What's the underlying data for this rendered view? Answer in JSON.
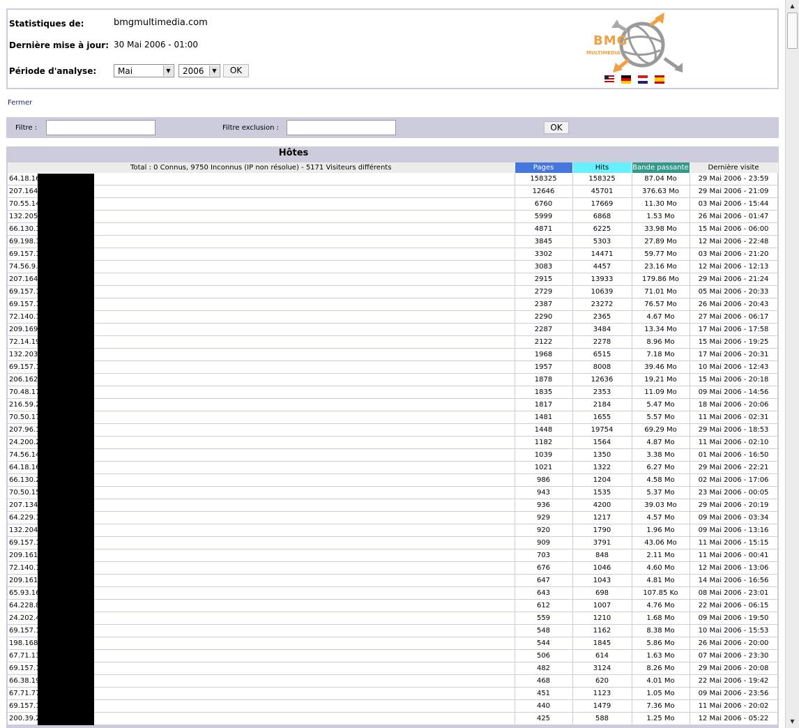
{
  "header": {
    "stats_label": "Statistiques de:",
    "site": "bmgmultimedia.com",
    "update_label": "Dernière mise à jour:",
    "update_value": "30 Mai 2006 - 01:00",
    "period_label": "Période d'analyse:",
    "month_selected": "Mai",
    "year_selected": "2006",
    "ok_label": "OK",
    "logo_text": "BMG",
    "logo_subtext": "MULTIMEDIA"
  },
  "close_link": "Fermer",
  "filter": {
    "filter_label": "Filtre :",
    "exclude_label": "Filtre exclusion :",
    "ok_label": "OK"
  },
  "hosts": {
    "title": "Hôtes",
    "summary": "Total : 0 Connus, 9750 Inconnus (IP non résolue) - 5171 Visiteurs différents",
    "columns": {
      "pages": "Pages",
      "hits": "Hits",
      "bandwidth": "Bande passante",
      "last_visit": "Dernière visite"
    },
    "colors": {
      "pages": "#4477dd",
      "hits": "#66f0ff",
      "bandwidth": "#339988",
      "panel": "#ccccdd"
    },
    "rows": [
      [
        "64.18.16",
        "158325",
        "158325",
        "87.04 Mo",
        "29 Mai 2006 - 23:59"
      ],
      [
        "207.164.",
        "12646",
        "45701",
        "376.63 Mo",
        "29 Mai 2006 - 21:09"
      ],
      [
        "70.55.14",
        "6760",
        "17669",
        "11.30 Mo",
        "03 Mai 2006 - 15:44"
      ],
      [
        "132.205.",
        "5999",
        "6868",
        "1.53 Mo",
        "26 Mai 2006 - 01:47"
      ],
      [
        "66.130.1",
        "4871",
        "6225",
        "33.98 Mo",
        "15 Mai 2006 - 06:00"
      ],
      [
        "69.198.1",
        "3845",
        "5303",
        "27.89 Mo",
        "12 Mai 2006 - 22:48"
      ],
      [
        "69.157.1",
        "3302",
        "14471",
        "59.77 Mo",
        "03 Mai 2006 - 21:20"
      ],
      [
        "74.56.9.2",
        "3083",
        "4457",
        "23.16 Mo",
        "12 Mai 2006 - 12:13"
      ],
      [
        "207.164.",
        "2915",
        "13933",
        "179.86 Mo",
        "29 Mai 2006 - 21:24"
      ],
      [
        "69.157.1",
        "2729",
        "10639",
        "71.01 Mo",
        "05 Mai 2006 - 20:33"
      ],
      [
        "69.157.1",
        "2387",
        "23272",
        "76.57 Mo",
        "26 Mai 2006 - 20:43"
      ],
      [
        "72.140.1",
        "2290",
        "2365",
        "4.67 Mo",
        "27 Mai 2006 - 06:17"
      ],
      [
        "209.169.",
        "2287",
        "3484",
        "13.34 Mo",
        "17 Mai 2006 - 17:58"
      ],
      [
        "72.14.19",
        "2122",
        "2278",
        "8.96 Mo",
        "15 Mai 2006 - 19:25"
      ],
      [
        "132.203.",
        "1968",
        "6515",
        "7.18 Mo",
        "17 Mai 2006 - 20:31"
      ],
      [
        "69.157.1",
        "1957",
        "8008",
        "39.46 Mo",
        "10 Mai 2006 - 12:43"
      ],
      [
        "206.162.",
        "1878",
        "12636",
        "19.21 Mo",
        "15 Mai 2006 - 20:18"
      ],
      [
        "70.48.17",
        "1835",
        "2353",
        "11.09 Mo",
        "09 Mai 2006 - 14:56"
      ],
      [
        "216.59.2",
        "1817",
        "2184",
        "5.47 Mo",
        "18 Mai 2006 - 20:06"
      ],
      [
        "70.50.17",
        "1481",
        "1655",
        "5.57 Mo",
        "11 Mai 2006 - 02:31"
      ],
      [
        "207.96.1",
        "1448",
        "19754",
        "69.29 Mo",
        "29 Mai 2006 - 18:53"
      ],
      [
        "24.200.2",
        "1182",
        "1564",
        "4.87 Mo",
        "11 Mai 2006 - 02:10"
      ],
      [
        "74.56.14",
        "1039",
        "1350",
        "3.38 Mo",
        "01 Mai 2006 - 16:50"
      ],
      [
        "64.18.16",
        "1021",
        "1322",
        "6.27 Mo",
        "29 Mai 2006 - 22:21"
      ],
      [
        "66.130.2",
        "986",
        "1204",
        "4.58 Mo",
        "02 Mai 2006 - 17:06"
      ],
      [
        "70.50.15",
        "943",
        "1535",
        "5.37 Mo",
        "23 Mai 2006 - 00:05"
      ],
      [
        "207.134.",
        "936",
        "4200",
        "39.03 Mo",
        "29 Mai 2006 - 20:19"
      ],
      [
        "64.229.1",
        "929",
        "1217",
        "4.57 Mo",
        "09 Mai 2006 - 03:34"
      ],
      [
        "132.204.",
        "920",
        "1790",
        "1.96 Mo",
        "09 Mai 2006 - 13:16"
      ],
      [
        "69.157.1",
        "909",
        "3791",
        "43.06 Mo",
        "11 Mai 2006 - 15:15"
      ],
      [
        "209.161.",
        "703",
        "848",
        "2.11 Mo",
        "11 Mai 2006 - 00:41"
      ],
      [
        "72.140.1",
        "676",
        "1046",
        "4.60 Mo",
        "12 Mai 2006 - 13:06"
      ],
      [
        "209.161.",
        "647",
        "1043",
        "4.81 Mo",
        "14 Mai 2006 - 16:56"
      ],
      [
        "65.93.16",
        "643",
        "698",
        "107.85 Ko",
        "08 Mai 2006 - 23:01"
      ],
      [
        "64.228.8",
        "612",
        "1007",
        "4.76 Mo",
        "22 Mai 2006 - 06:15"
      ],
      [
        "24.202.4",
        "559",
        "1210",
        "1.68 Mo",
        "09 Mai 2006 - 19:50"
      ],
      [
        "69.157.1",
        "548",
        "1162",
        "8.38 Mo",
        "10 Mai 2006 - 15:53"
      ],
      [
        "198.168.",
        "544",
        "1845",
        "5.86 Mo",
        "26 Mai 2006 - 20:00"
      ],
      [
        "67.71.13",
        "506",
        "614",
        "1.63 Mo",
        "07 Mai 2006 - 23:30"
      ],
      [
        "69.157.1",
        "482",
        "3124",
        "8.26 Mo",
        "29 Mai 2006 - 20:08"
      ],
      [
        "66.38.19",
        "468",
        "620",
        "4.01 Mo",
        "22 Mai 2006 - 19:42"
      ],
      [
        "67.71.77",
        "451",
        "1123",
        "1.05 Mo",
        "09 Mai 2006 - 23:56"
      ],
      [
        "69.157.1",
        "440",
        "1479",
        "7.36 Mo",
        "11 Mai 2006 - 20:02"
      ],
      [
        "200.39.2",
        "425",
        "588",
        "1.25 Mo",
        "12 Mai 2006 - 05:22"
      ]
    ]
  }
}
